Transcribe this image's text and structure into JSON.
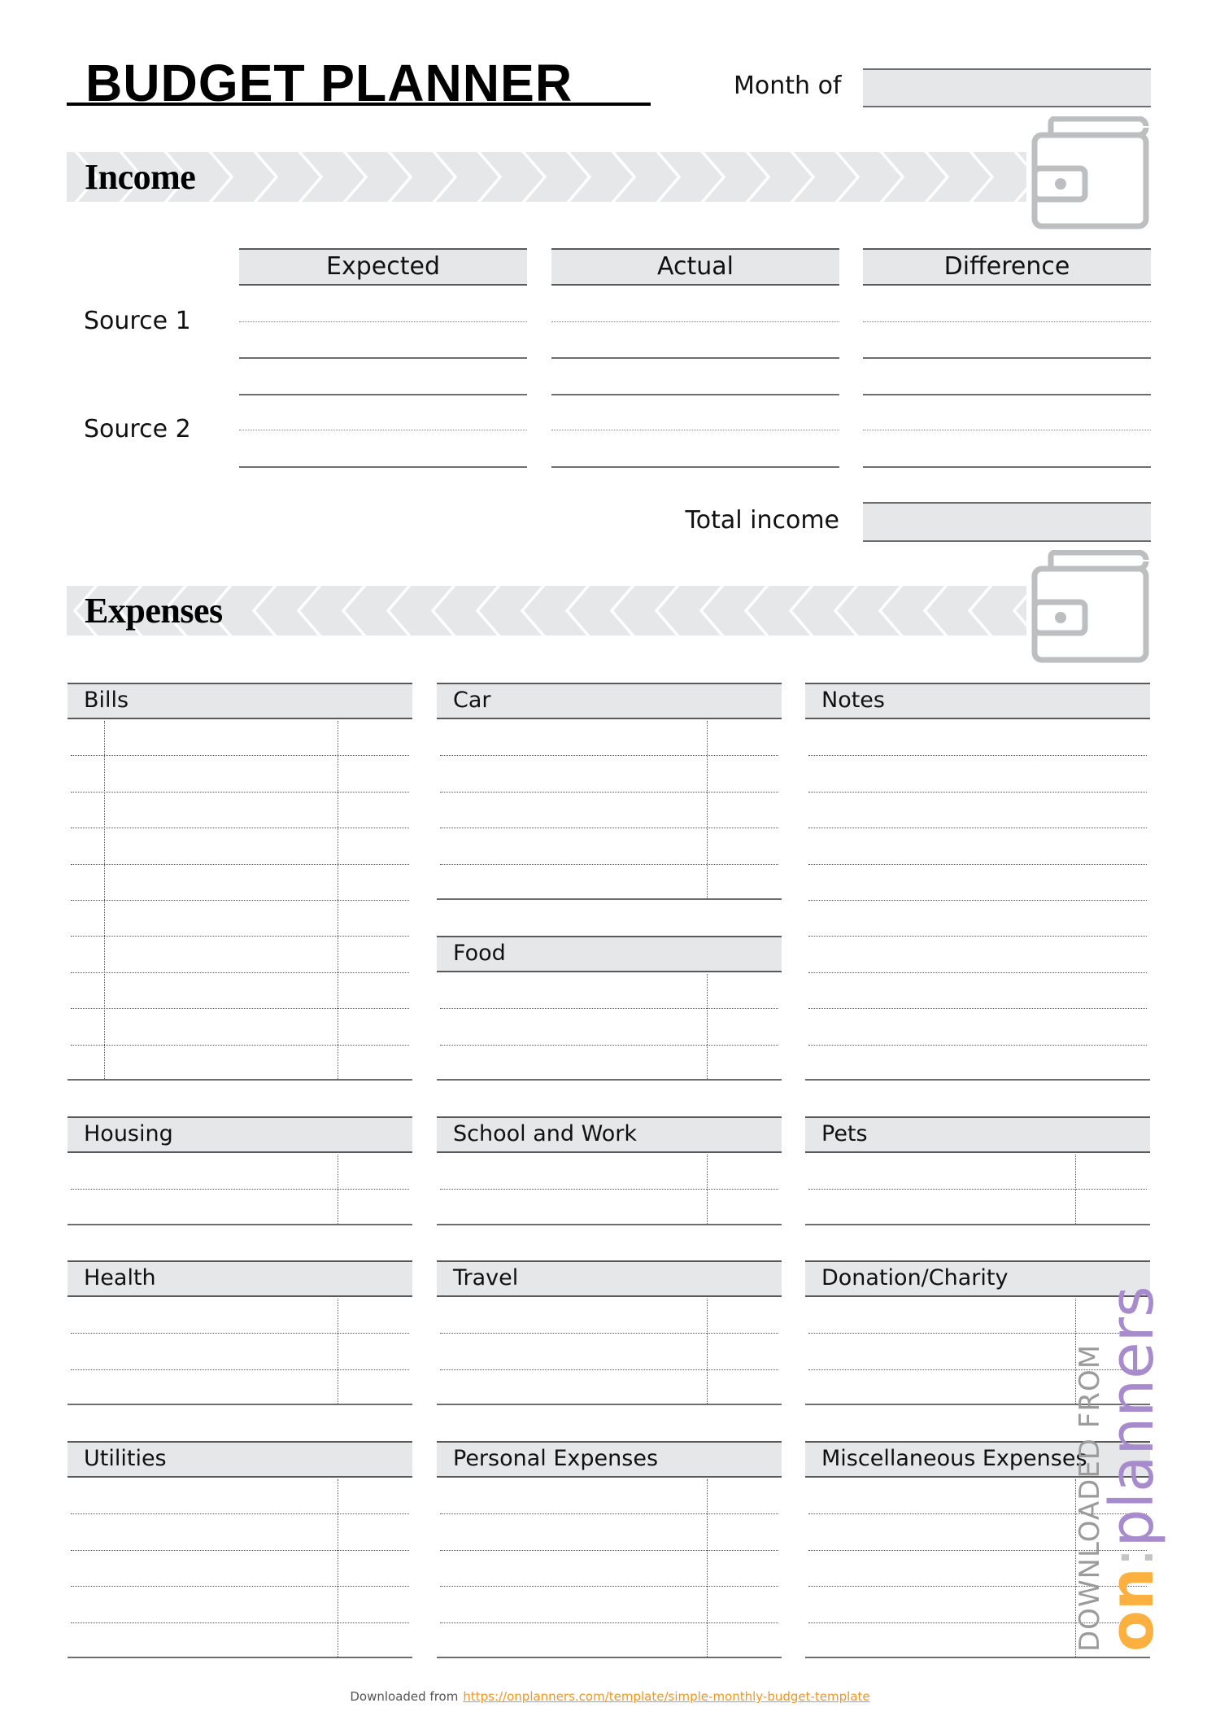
{
  "header": {
    "title": "BUDGET PLANNER",
    "month_label": "Month of",
    "month_value": ""
  },
  "income": {
    "section_title": "Income",
    "section_icon": "wallet-icon",
    "columns": [
      "Expected",
      "Actual",
      "Difference"
    ],
    "sources": [
      {
        "label": "Source 1",
        "expected": "",
        "actual": "",
        "difference": ""
      },
      {
        "label": "Source 2",
        "expected": "",
        "actual": "",
        "difference": ""
      }
    ],
    "total_label": "Total income",
    "total_value": ""
  },
  "expenses": {
    "section_title": "Expenses",
    "section_icon": "wallet-icon",
    "categories": [
      {
        "name": "Bills",
        "rows": 10
      },
      {
        "name": "Car",
        "rows": 5
      },
      {
        "name": "Notes",
        "rows": 10
      },
      {
        "name": "Food",
        "rows": 3
      },
      {
        "name": "Housing",
        "rows": 2
      },
      {
        "name": "School and Work",
        "rows": 2
      },
      {
        "name": "Pets",
        "rows": 2
      },
      {
        "name": "Health",
        "rows": 3
      },
      {
        "name": "Travel",
        "rows": 3
      },
      {
        "name": "Donation/Charity",
        "rows": 3
      },
      {
        "name": "Utilities",
        "rows": 5
      },
      {
        "name": "Personal Expenses",
        "rows": 5
      },
      {
        "name": "Miscellaneous Expenses",
        "rows": 5
      }
    ]
  },
  "watermark": {
    "prefix": "DOWNLOADED FROM",
    "brand_on": "on",
    "brand_sep": ":",
    "brand_planners": "planners"
  },
  "footer": {
    "text": "Downloaded from",
    "link": "https://onplanners.com/template/simple-monthly-budget-template"
  },
  "colors": {
    "fill_gray": "#e6e7e8",
    "rule_dark": "#58595b",
    "icon_gray": "#bcbec0",
    "brand_orange": "#fbb040",
    "brand_purple": "#a78bcc",
    "link_orange": "#f7941d"
  }
}
